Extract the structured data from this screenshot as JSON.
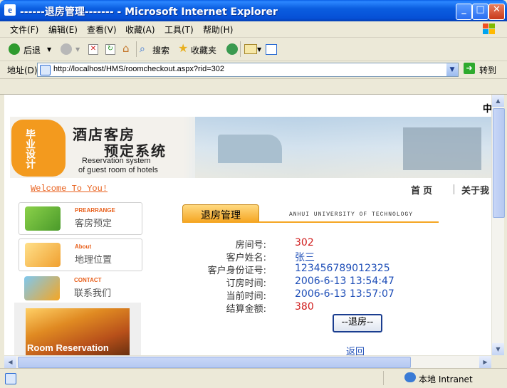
{
  "window": {
    "title": "------退房管理------- - Microsoft Internet Explorer"
  },
  "menu": [
    "文件(F)",
    "编辑(E)",
    "查看(V)",
    "收藏(A)",
    "工具(T)",
    "帮助(H)"
  ],
  "toolbar": {
    "back_label": "后退",
    "search_label": "搜索",
    "favorites_label": "收藏夹"
  },
  "address": {
    "label": "地址(D)",
    "value": "http://localhost/HMS/roomcheckout.aspx?rid=302",
    "go_label": "转到"
  },
  "status": {
    "zone": "本地 Intranet"
  },
  "page": {
    "corner_char": "中",
    "brand": {
      "cn_line1": "酒店客房",
      "cn_line2": "预定系统",
      "en_line1": "Reservation system",
      "en_line2": "of guest room of hotels",
      "logo_text": "毕业设计"
    },
    "welcome": "Welcome To You!",
    "nav": {
      "home": "首页",
      "about": "关于我"
    },
    "sidebar": [
      {
        "en": "PREARRANGE",
        "cn": "客房预定"
      },
      {
        "en": "About",
        "cn": "地理位置"
      },
      {
        "en": "CONTACT",
        "cn": "联系我们"
      }
    ],
    "side_photo_caption": "Room Reservation",
    "section_title": "退房管理",
    "university": "ANHUI UNIVERSITY OF TECHNOLOGY",
    "fields": [
      {
        "label": "房间号:",
        "value": "302",
        "color": "red"
      },
      {
        "label": "客户姓名:",
        "value": "张三",
        "color": "blue"
      },
      {
        "label": "客户身份证号:",
        "value": "123456789012325",
        "color": "blue"
      },
      {
        "label": "订房时间:",
        "value": "2006-6-13 13:54:47",
        "color": "blue"
      },
      {
        "label": "当前时间:",
        "value": "2006-6-13 13:57:07",
        "color": "blue"
      },
      {
        "label": "结算金额:",
        "value": "380",
        "color": "red"
      }
    ],
    "checkout_button": "--退房--",
    "back_link": "返回"
  }
}
